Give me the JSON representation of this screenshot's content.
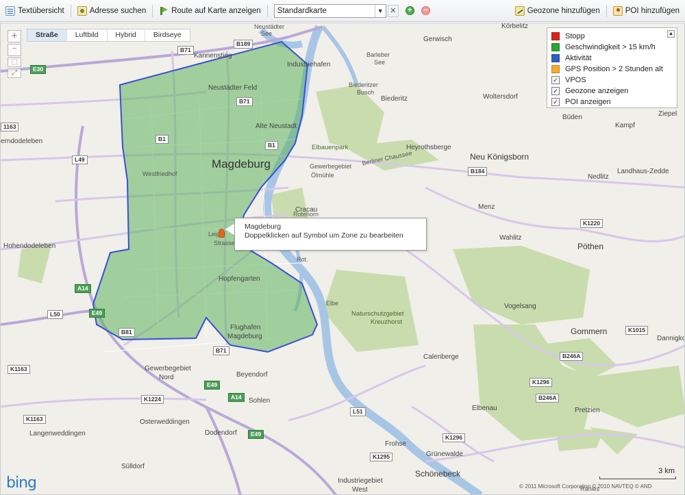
{
  "toolbar": {
    "text_overview": "Textübersicht",
    "address_search": "Adresse suchen",
    "route_on_map": "Route auf Karte anzeigen",
    "map_select_value": "Standardkarte",
    "add_geozone": "Geozone hinzufügen",
    "add_poi": "POI hinzufügen",
    "icons": {
      "text_overview": "list-icon",
      "address_search": "map-search-icon",
      "route": "route-flag-icon",
      "add": "plus-circle-icon",
      "remove": "minus-circle-icon",
      "geozone": "geozone-icon",
      "poi": "poi-icon"
    }
  },
  "map_style": {
    "tabs": [
      "Straße",
      "Luftbild",
      "Hybrid",
      "Birdseye"
    ],
    "active": "Straße"
  },
  "zoom": {
    "plus": "+",
    "minus": "−"
  },
  "legend": {
    "items": [
      {
        "label": "Stopp",
        "color": "#d9221c"
      },
      {
        "label": "Geschwindigkeit > 15 km/h",
        "color": "#2ea33a"
      },
      {
        "label": "Aktivität",
        "color": "#2f5fc4"
      },
      {
        "label": "GPS Position > 2 Stunden alt",
        "color": "#f4a92e"
      }
    ],
    "checks": [
      {
        "label": "VPOS",
        "checked": true
      },
      {
        "label": "Geozone anzeigen",
        "checked": true
      },
      {
        "label": "POI anzeigen",
        "checked": true
      }
    ]
  },
  "tooltip": {
    "title": "Magdeburg",
    "text": "Doppelklicken auf Symbol um Zone zu bearbeiten"
  },
  "map_labels": {
    "magdeburg": "Magdeburg",
    "kannenstieg": "Kannenstieg",
    "industriehafen": "Industriehafen",
    "neustaedter_feld": "Neustädter Feld",
    "alte_neustadt": "Alte Neustadt",
    "westfriedhof": "Westfriedhof",
    "olmuehle": "Ölmühle",
    "gewerbegebiet": "Gewerbegebiet",
    "cracau": "Cracau",
    "rotehorn": "Rotehorn",
    "leipziger": "Leipz",
    "strasse": "Strasse",
    "hopfengarten": "Hopfengarten",
    "flughafen": "Flughafen",
    "magdeburg2": "Magdeburg",
    "hohendodeleben": "Hohendodeleben",
    "gewerbegebiet_nord": "Gewerbegebiet",
    "nord": "Nord",
    "beyendorf": "Beyendorf",
    "sohlen": "Sohlen",
    "osterweddingen": "Osterweddingen",
    "dodendorf": "Dodendorf",
    "langenweddingen": "Langenweddingen",
    "sulldorf": "Sülldorf",
    "gerwisch": "Gerwisch",
    "biederitz": "Biederitz",
    "biederitzer_busch": "Biederitzer",
    "busch": "Busch",
    "woltersdorf": "Woltersdorf",
    "heyrothsberge": "Heyrothsberge",
    "neu_koenigsborn": "Neu Königsborn",
    "landhaus": "Landhaus-Zedde",
    "nedlitz": "Nedlitz",
    "menz": "Menz",
    "wahlitz": "Wahlitz",
    "poethen": "Pöthen",
    "vogelsang": "Vogelsang",
    "gommern": "Gommern",
    "dannigkow": "Dannigkow",
    "calenberge": "Calenberge",
    "elbenau": "Elbenau",
    "pretzien": "Pretzien",
    "frohse": "Frohse",
    "gruenewalde": "Grünewalde",
    "schoenebeck": "Schönebeck",
    "industriegebiet_west": "Industriegebiet",
    "west": "West",
    "ranies": "Ranies",
    "buden": "Büden",
    "kampf": "Kampf",
    "ziepel": "Ziepel",
    "korbelitz": "Körbelitz",
    "erndodeleben": "erndodeleben",
    "elbauenpark": "Elbauenpark",
    "naturschutzgebiet": "Naturschutzgebiet",
    "kreuzhorst": "Kreuzhorst",
    "neustaedter_see": "Neustädter",
    "see": "See",
    "barleber_see": "Barleber",
    "barleber_see2": "See",
    "elbe": "Elbe",
    "rot_see": "Rot.",
    "berliner_chaussee": "Berliner Chaussee"
  },
  "road_shields": [
    "B189",
    "B71",
    "E30",
    "B71",
    "B1",
    "B1",
    "L49",
    "1163",
    "B184",
    "K1220",
    "A14",
    "L50",
    "E49",
    "B81",
    "K1163",
    "B71",
    "E49",
    "A14",
    "K1224",
    "K1163",
    "L51",
    "E49",
    "K1296",
    "K1295",
    "K1015",
    "B246A",
    "B246A",
    "K1296"
  ],
  "scale": {
    "label": "3 km"
  },
  "attribution": {
    "brand": "bing",
    "copyright": "© 2011 Microsoft Corporation    © 2010 NAVTEQ    © AND"
  }
}
